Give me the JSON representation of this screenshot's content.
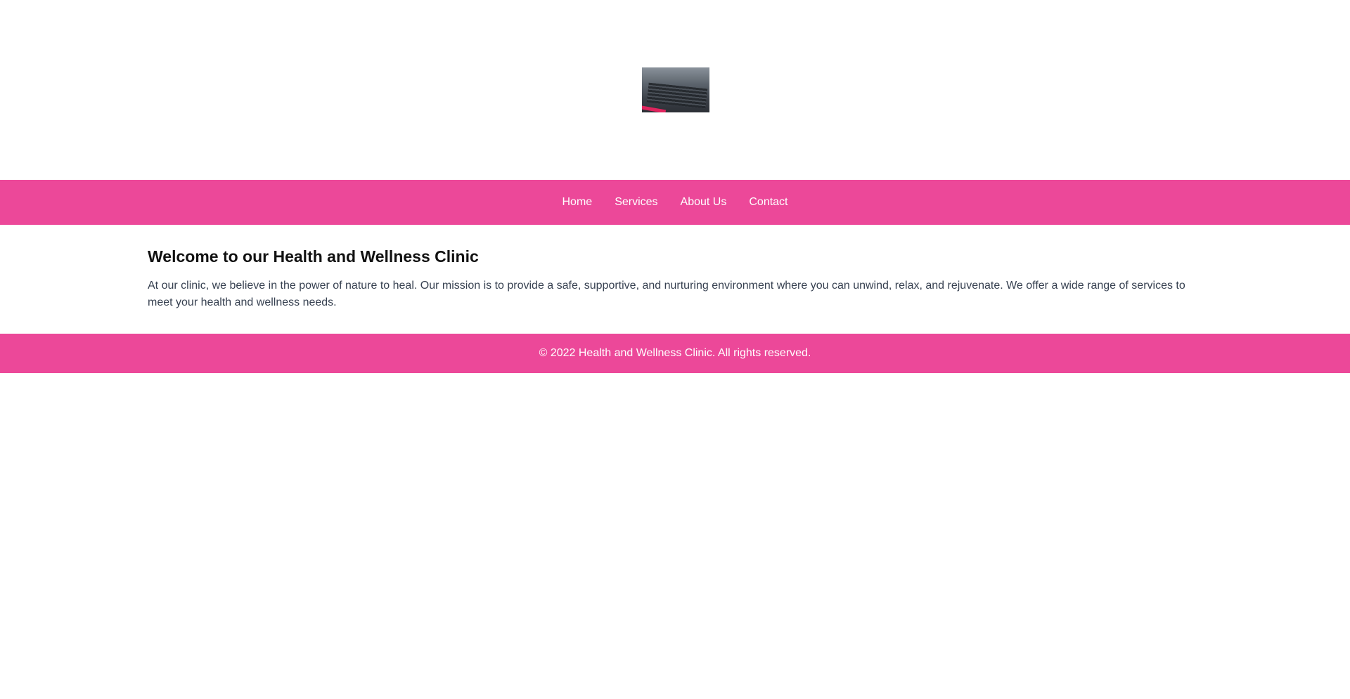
{
  "colors": {
    "brand_pink": "#ec4899",
    "text_dark": "#111111",
    "text_body": "#374151",
    "nav_text": "#ffffff"
  },
  "header": {
    "logo_icon": "car-grille-photo"
  },
  "nav": {
    "items": [
      {
        "label": "Home"
      },
      {
        "label": "Services"
      },
      {
        "label": "About Us"
      },
      {
        "label": "Contact"
      }
    ]
  },
  "main": {
    "title": "Welcome to our Health and Wellness Clinic",
    "body": "At our clinic, we believe in the power of nature to heal. Our mission is to provide a safe, supportive, and nurturing environment where you can unwind, relax, and rejuvenate. We offer a wide range of services to meet your health and wellness needs."
  },
  "footer": {
    "text": "© 2022 Health and Wellness Clinic. All rights reserved."
  }
}
